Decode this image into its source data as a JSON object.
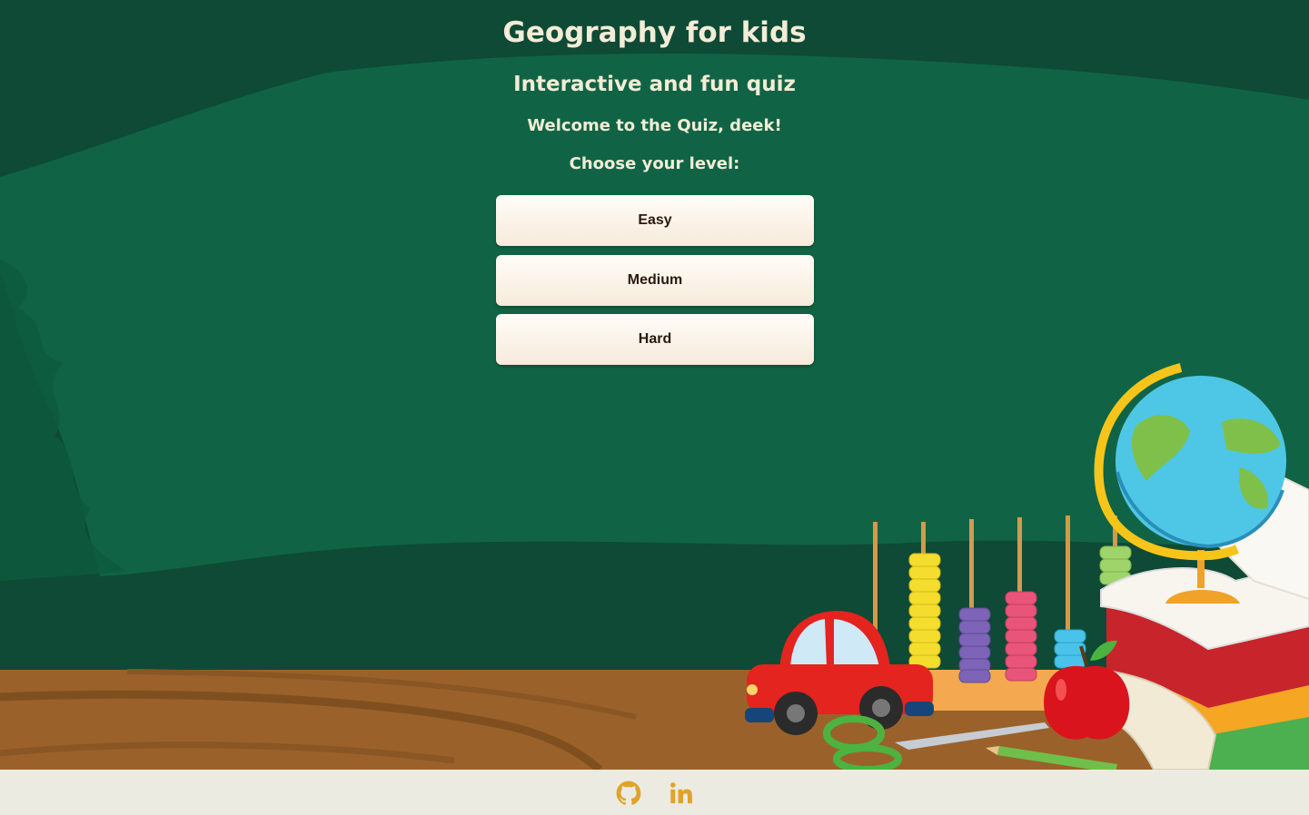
{
  "header": {
    "title": "Geography for kids",
    "subtitle": "Interactive and fun quiz",
    "welcome": "Welcome to the Quiz, deek!",
    "choose_prompt": "Choose your level:"
  },
  "levels": [
    {
      "label": "Easy"
    },
    {
      "label": "Medium"
    },
    {
      "label": "Hard"
    }
  ],
  "footer": {
    "icons": [
      "github-icon",
      "linkedin-icon"
    ]
  },
  "colors": {
    "chalkboard": "#0f5e42",
    "chalkboard_dark": "#0e4a36",
    "desk": "#9a622a",
    "heading_text": "#f3ecd6",
    "button_text": "#2a1a0e",
    "footer_bg": "#ecebe1",
    "icon_accent": "#e0a32a"
  }
}
